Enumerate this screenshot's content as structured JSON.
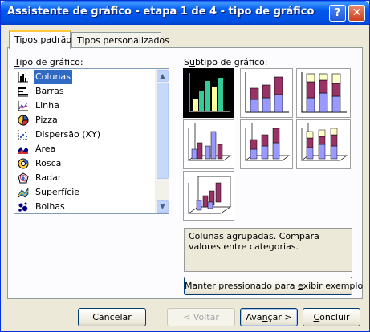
{
  "window": {
    "title": "Assistente de gráfico - etapa 1 de 4 - tipo de gráfico"
  },
  "titlebar_buttons": {
    "help": "?",
    "close": "✕"
  },
  "tabs": [
    {
      "label": "Tipos padrão",
      "active": true
    },
    {
      "label": "Tipos personalizados",
      "active": false
    }
  ],
  "chart_type": {
    "label_prefix": "",
    "label_accel": "T",
    "label_rest": "ipo de gráfico:",
    "items": [
      {
        "label": "Colunas",
        "icon": "column-chart-icon",
        "selected": true
      },
      {
        "label": "Barras",
        "icon": "bar-chart-icon"
      },
      {
        "label": "Linha",
        "icon": "line-chart-icon"
      },
      {
        "label": "Pizza",
        "icon": "pie-chart-icon"
      },
      {
        "label": "Dispersão (XY)",
        "icon": "scatter-chart-icon"
      },
      {
        "label": "Área",
        "icon": "area-chart-icon"
      },
      {
        "label": "Rosca",
        "icon": "doughnut-chart-icon"
      },
      {
        "label": "Radar",
        "icon": "radar-chart-icon"
      },
      {
        "label": "Superfície",
        "icon": "surface-chart-icon"
      },
      {
        "label": "Bolhas",
        "icon": "bubble-chart-icon"
      }
    ]
  },
  "subtype": {
    "label_prefix": "S",
    "label_accel": "u",
    "label_rest": "btipo de gráfico:",
    "selected_index": 0,
    "description": "Colunas agrupadas. Compara valores entre categorias."
  },
  "buttons": {
    "hold_prefix": "Manter pressionado para ",
    "hold_accel": "e",
    "hold_rest": "xibir exemplo",
    "cancel": "Cancelar",
    "back": "< Voltar",
    "next_prefix": "Ava",
    "next_accel": "n",
    "next_rest": "çar >",
    "finish_prefix": "",
    "finish_accel": "C",
    "finish_rest": "oncluir"
  },
  "colors": {
    "series1": "#9999ff",
    "series2": "#993366",
    "series3": "#ffffcc",
    "selected_bg": "#000000",
    "selected_bar_green": "#33cc99",
    "selected_bar_yellow": "#ffff99"
  }
}
